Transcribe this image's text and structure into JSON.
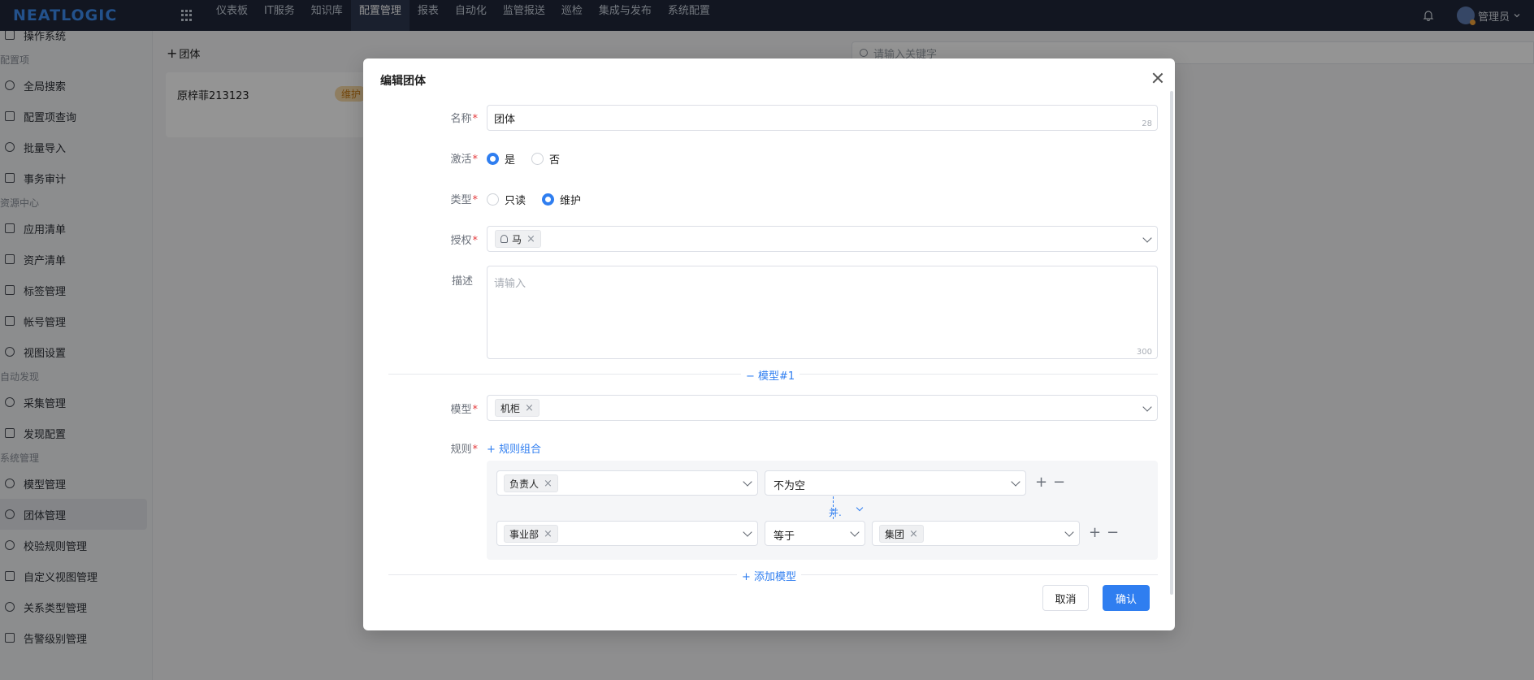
{
  "topbar": {
    "logo": "NEATLOGIC",
    "nav": [
      "仪表板",
      "IT服务",
      "知识库",
      "配置管理",
      "报表",
      "自动化",
      "监管报送",
      "巡检",
      "集成与发布",
      "系统配置"
    ],
    "active_nav": "配置管理",
    "user_name": "管理员",
    "user_menu_icon": "chevron-down-icon"
  },
  "sidebar": {
    "partial_top": "操作系统",
    "groups": [
      {
        "title": "配置项",
        "items": [
          "全局搜索",
          "配置项查询",
          "批量导入",
          "事务审计"
        ]
      },
      {
        "title": "资源中心",
        "items": [
          "应用清单",
          "资产清单",
          "标签管理",
          "帐号管理",
          "视图设置"
        ]
      },
      {
        "title": "自动发现",
        "items": [
          "采集管理",
          "发现配置"
        ]
      },
      {
        "title": "系统管理",
        "items": [
          "模型管理",
          "团体管理",
          "校验规则管理",
          "自定义视图管理",
          "关系类型管理",
          "告警级别管理"
        ]
      }
    ],
    "active_item": "团体管理"
  },
  "page": {
    "add_button": "团体",
    "card": {
      "name": "原梓菲213123",
      "badge": "维护"
    },
    "search_placeholder": "请输入关键字"
  },
  "modal": {
    "title": "编辑团体",
    "name_label": "名称",
    "name_value": "团体",
    "name_count": "28",
    "active_label": "激活",
    "active_options": [
      "是",
      "否"
    ],
    "active_selected": "是",
    "type_label": "类型",
    "type_options": [
      "只读",
      "维护"
    ],
    "type_selected": "维护",
    "auth_label": "授权",
    "auth_tag": "马",
    "desc_label": "描述",
    "desc_placeholder": "请输入",
    "desc_count": "300",
    "model_section": "模型#1",
    "model_label": "模型",
    "model_tag": "机柜",
    "rule_label": "规则",
    "rule_group_link": "规则组合",
    "rules": {
      "row1": {
        "field": "负责人",
        "operator": "不为空"
      },
      "row2": {
        "field": "事业部",
        "operator": "等于",
        "value": "集团"
      },
      "conjunction": "并."
    },
    "add_model": "添加模型",
    "cancel": "取消",
    "confirm": "确认"
  },
  "colors": {
    "primary": "#2f7ef0",
    "topbar": "#1f2739",
    "required": "#e4393c",
    "badge": "#c87d17"
  }
}
